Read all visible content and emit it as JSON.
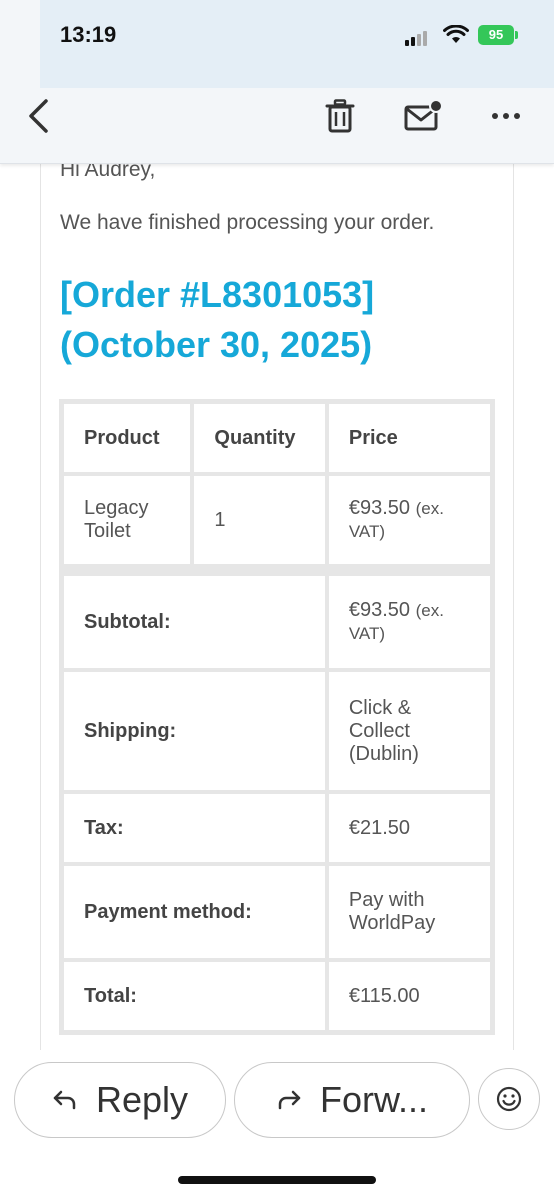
{
  "status_bar": {
    "time": "13:19",
    "battery": "95"
  },
  "toolbar": {
    "back_icon": "chevron-left-icon",
    "trash_icon": "trash-icon",
    "unread_icon": "mail-unread-icon",
    "more_icon": "more-horizontal-icon"
  },
  "email": {
    "greeting": "Hi Audrey,",
    "intro": "We have finished processing your order.",
    "order_heading_line1": "[Order #L8301053]",
    "order_heading_line2": "(October 30, 2025)",
    "accent_color": "#16a8d8",
    "table": {
      "headers": [
        "Product",
        "Quantity",
        "Price"
      ],
      "item": {
        "product_line1": "Legacy",
        "product_line2": "Toilet",
        "quantity": "1",
        "price_line1": "€93.50",
        "price_suffix": "(ex.",
        "price_line2": "VAT)"
      },
      "subtotal": {
        "label": "Subtotal:",
        "value_line1": "€93.50",
        "value_suffix": "(ex.",
        "value_line2": "VAT)"
      },
      "shipping": {
        "label": "Shipping:",
        "value_line1": "Click &",
        "value_line2": "Collect",
        "value_line3": "(Dublin)"
      },
      "tax": {
        "label": "Tax:",
        "value": "€21.50"
      },
      "payment": {
        "label": "Payment method:",
        "value_line1": "Pay with",
        "value_line2": "WorldPay"
      },
      "total": {
        "label": "Total:",
        "value": "€115.00"
      }
    }
  },
  "actions": {
    "reply_label": "Reply",
    "forward_label": "Forw...",
    "reply_icon": "reply-arrow-icon",
    "forward_icon": "forward-arrow-icon",
    "emoji_icon": "smiley-icon"
  }
}
